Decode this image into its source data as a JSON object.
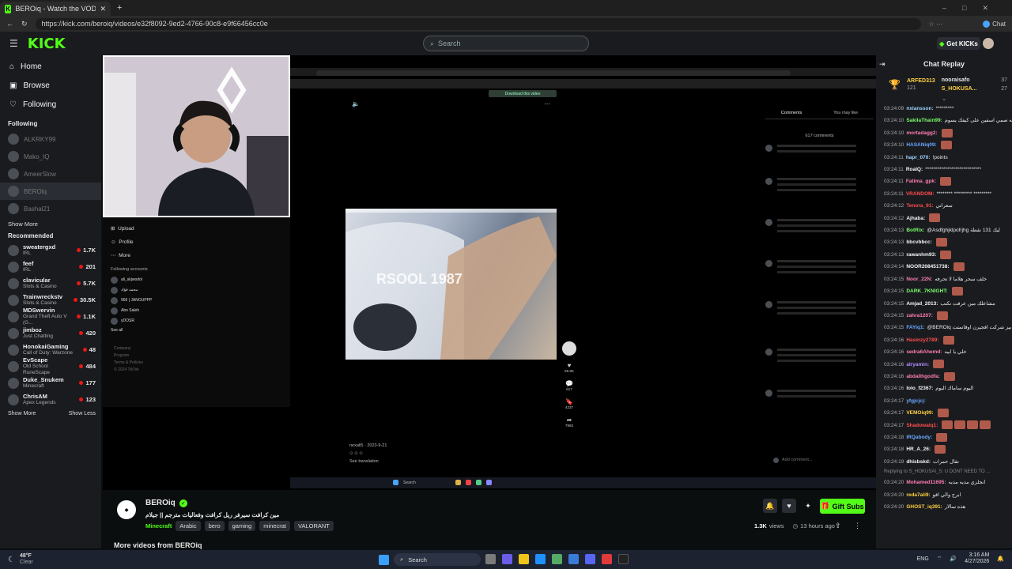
{
  "browser": {
    "tab_title": "BEROiq - Watch the VOD on Kick",
    "url": "https://kick.com/beroiq/videos/e32f8092-9ed2-4766-90c8-e9f66456cc0e",
    "chat_label": "Chat"
  },
  "header": {
    "logo": "KICK",
    "search_placeholder": "Search",
    "get_kicks": "Get KICKs"
  },
  "sidebar": {
    "nav": [
      {
        "label": "Home"
      },
      {
        "label": "Browse"
      },
      {
        "label": "Following"
      }
    ],
    "following_title": "Following",
    "following": [
      "ALKRKY99",
      "Mako_IQ",
      "AmeerSlow",
      "BEROiq",
      "Bashal21"
    ],
    "show_more_1": "Show More",
    "recommended_title": "Recommended",
    "recommended": [
      {
        "name": "sweatergxd",
        "category": "IRL",
        "viewers": "1.7K"
      },
      {
        "name": "feef",
        "category": "IRL",
        "viewers": "201"
      },
      {
        "name": "clavicular",
        "category": "Slots & Casino",
        "viewers": "5.7K"
      },
      {
        "name": "Trainwreckstv",
        "category": "Slots & Casino",
        "viewers": "30.5K"
      },
      {
        "name": "MDSwervin",
        "category": "Grand Theft Auto V (G...",
        "viewers": "1.1K"
      },
      {
        "name": "jimboz",
        "category": "Just Chatting",
        "viewers": "420"
      },
      {
        "name": "HonokaiGaming",
        "category": "Call of Duty: Warzone",
        "viewers": "48"
      },
      {
        "name": "EvScape",
        "category": "Old School RuneScape",
        "viewers": "484"
      },
      {
        "name": "Duke_Snukem",
        "category": "Minecraft",
        "viewers": "177"
      },
      {
        "name": "ChrisAM",
        "category": "Apex Legends",
        "viewers": "123"
      }
    ],
    "show_more_2": "Show More",
    "show_less": "Show Less"
  },
  "video": {
    "clip_text": "RSOOL 1987",
    "inner_download": "Download this video",
    "tiktok_menu": [
      "Upload",
      "Profile",
      "More"
    ],
    "following_accounts_title": "Following accounts",
    "following_accounts": [
      "ali_skjwodol",
      "محمد فؤاد",
      "966 | JANOUPPP",
      "Abo Saleh",
      "yDOSR"
    ],
    "see_all": "See all",
    "footer_links": [
      "Company",
      "Program",
      "Terms & Policies",
      "© 2024 TikTok"
    ],
    "comments_tab": "Comments",
    "you_may_like_tab": "You may like",
    "comments_count": "617 comments",
    "author": "nexali5",
    "post_date": "2023-9-21",
    "add_comment": "Add comment...",
    "see_translation": "See translation",
    "counts": [
      "59.9K",
      "617",
      "4237",
      "7993"
    ],
    "inner_search": "Search"
  },
  "stream": {
    "channel": "BEROiq",
    "title": "مين كرافت سيرفر ريل كرافت وفعاليات مترجم || جيلام",
    "tags": [
      "Minecraft",
      "Arabic",
      "bero",
      "gaming",
      "minecrat",
      "VALORANT"
    ],
    "views": "1.3K",
    "views_label": "views",
    "time_ago": "13 hours ago",
    "gift_subs": "Gift Subs",
    "more_videos": "More videos from BEROiq"
  },
  "chat": {
    "title": "Chat Replay",
    "gifters": [
      {
        "name": "ARFED313",
        "count": "121"
      },
      {
        "name": "nooraisafo",
        "count": "37"
      },
      {
        "name": "S_HOKUSA...",
        "count": "27"
      }
    ],
    "messages": [
      {
        "time": "03:24:09",
        "user": "nxlansson:",
        "color": "#9fd3ff",
        "text": "*********",
        "emotes": 0
      },
      {
        "time": "03:24:10",
        "user": "SakilaThain99:",
        "color": "#7cfc6a",
        "text": "والله صمي اسفين على كيفك يسوم",
        "emotes": 0
      },
      {
        "time": "03:24:10",
        "user": "mortadagg2:",
        "color": "#ff7eb3",
        "text": "",
        "emotes": 1
      },
      {
        "time": "03:24:10",
        "user": "HASANiq09:",
        "color": "#6aa8ff",
        "text": "",
        "emotes": 1
      },
      {
        "time": "03:24:11",
        "user": "hapr_070:",
        "color": "#9fd3ff",
        "text": "!points",
        "emotes": 0
      },
      {
        "time": "03:24:11",
        "user": "RoaIQ:",
        "color": "#f5f5f5",
        "text": "****************************",
        "emotes": 0
      },
      {
        "time": "03:24:11",
        "user": "Fatima_gpk:",
        "color": "#ff7eb3",
        "text": "",
        "emotes": 1
      },
      {
        "time": "03:24:11",
        "user": "VRANDOM:",
        "color": "#ff4d4d",
        "text": "******** ********* *********",
        "emotes": 0
      },
      {
        "time": "03:24:12",
        "user": "Tenora_91:",
        "color": "#ff4d4d",
        "text": "سعراني",
        "emotes": 0
      },
      {
        "time": "03:24:12",
        "user": "Ajhaba:",
        "color": "#f5f5f5",
        "text": "",
        "emotes": 1
      },
      {
        "time": "03:24:13",
        "user": "BotRix:",
        "color": "#7cfc6a",
        "text": "@Asdfghjklpofrjhg ليك 131 نقطة",
        "emotes": 0
      },
      {
        "time": "03:24:13",
        "user": "bbcvbbcc:",
        "color": "#f5f5f5",
        "text": "",
        "emotes": 1
      },
      {
        "time": "03:24:13",
        "user": "rawanhm93:",
        "color": "#f5f5f5",
        "text": "",
        "emotes": 1
      },
      {
        "time": "03:24:14",
        "user": "NOOR208451738:",
        "color": "#f5f5f5",
        "text": "",
        "emotes": 1
      },
      {
        "time": "03:24:15",
        "user": "Noor_22N:",
        "color": "#ff7eb3",
        "text": "خلف سحر هلاما لا تحرفه",
        "emotes": 0
      },
      {
        "time": "03:24:15",
        "user": "DARK_7KNIGHT:",
        "color": "#7cfc6a",
        "text": "",
        "emotes": 1
      },
      {
        "time": "03:24:15",
        "user": "Amjad_2013:",
        "color": "#f5f5f5",
        "text": "مشاعلك مين عرفت نكتب",
        "emotes": 0
      },
      {
        "time": "03:24:15",
        "user": "zahra1207:",
        "color": "#ff7eb3",
        "text": "",
        "emotes": 1
      },
      {
        "time": "03:24:15",
        "user": "FAYiq1:",
        "color": "#6aa8ff",
        "text": "@BEROiq بيز شركت افجيرن اوقاتمتت",
        "emotes": 0
      },
      {
        "time": "03:24:16",
        "user": "Hasinzy2789:",
        "color": "#ff4d4d",
        "text": "",
        "emotes": 1
      },
      {
        "time": "03:24:16",
        "user": "sedra6Ahemd:",
        "color": "#ff7eb3",
        "text": "خلي يا ابيه",
        "emotes": 0
      },
      {
        "time": "03:24:16",
        "user": "alryamin:",
        "color": "#b38cff",
        "text": "",
        "emotes": 1
      },
      {
        "time": "03:24:16",
        "user": "abdallhgodfa:",
        "color": "#ff7eb3",
        "text": "",
        "emotes": 1
      },
      {
        "time": "03:24:16",
        "user": "lolo_f2367:",
        "color": "#f5f5f5",
        "text": "اليوم ساماك اليوم",
        "emotes": 0
      },
      {
        "time": "03:24:17",
        "user": "yfgjcjcj:",
        "color": "#6aa8ff",
        "text": "",
        "emotes": 0
      },
      {
        "time": "03:24:17",
        "user": "VEMOiq99:",
        "color": "#ffd23f",
        "text": "",
        "emotes": 1
      },
      {
        "time": "03:24:17",
        "user": "Shadowalq1:",
        "color": "#ff4d4d",
        "text": "",
        "emotes": 4
      },
      {
        "time": "03:24:18",
        "user": "IRQabody:",
        "color": "#6aa8ff",
        "text": "",
        "emotes": 1
      },
      {
        "time": "03:24:18",
        "user": "HR_A_26:",
        "color": "#f5f5f5",
        "text": "",
        "emotes": 1
      },
      {
        "time": "03:24:19",
        "user": "dhisbskd:",
        "color": "#f5f5f5",
        "text": "نقال حمرات",
        "emotes": 0
      }
    ],
    "reply_note": "Replying to S_HOKUSAI_S: U DONT NEED TO ...",
    "tail": [
      {
        "time": "03:24:20",
        "user": "Mohamed11695:",
        "color": "#ff7eb3",
        "text": "انجلزي مديه مديه",
        "emotes": 0
      },
      {
        "time": "03:24:20",
        "user": "reda7ali9:",
        "color": "#ffd23f",
        "text": "ابرج والي اقو",
        "emotes": 0
      },
      {
        "time": "03:24:20",
        "user": "GHOST_iq391:",
        "color": "#ffd23f",
        "text": "هذه سالار",
        "emotes": 0
      }
    ]
  },
  "taskbar": {
    "temp": "48°F",
    "weather": "Clear",
    "search": "Search",
    "lang": "ENG",
    "time": "3:16 AM",
    "date": "4/27/2026"
  }
}
